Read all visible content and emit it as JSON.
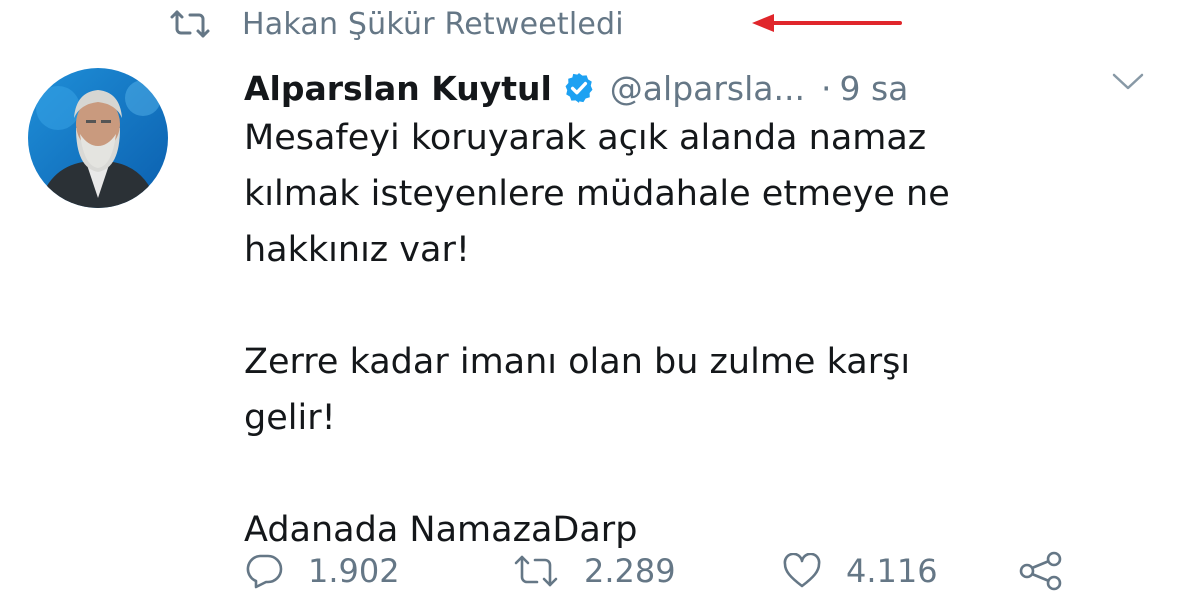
{
  "retweet_context": {
    "text": "Hakan Şükür Retweetledi"
  },
  "annotation": {
    "arrow_color": "#e0262b"
  },
  "tweet": {
    "display_name": "Alparslan Kuytul",
    "verified": true,
    "handle": "@alparsla...",
    "separator": "·",
    "time": "9 sa",
    "body": {
      "paragraphs": [
        {
          "lines": [
            "Mesafeyi koruyarak açık alanda namaz",
            "kılmak isteyenlere müdahale etmeye ne",
            "hakkınız var!"
          ]
        },
        {
          "lines": [
            "Zerre kadar imanı olan bu zulme karşı",
            "gelir!"
          ]
        },
        {
          "lines": [
            "Adanada NamazaDarp"
          ]
        }
      ]
    },
    "actions": {
      "replies": "1.902",
      "retweets": "2.289",
      "likes": "4.116"
    }
  },
  "colors": {
    "verified_blue": "#1da1f2",
    "muted_text": "#657786",
    "primary_text": "#14171a"
  },
  "icons": [
    "retweet-icon",
    "verified-badge-icon",
    "chevron-down-icon",
    "reply-icon",
    "like-icon",
    "share-icon"
  ]
}
